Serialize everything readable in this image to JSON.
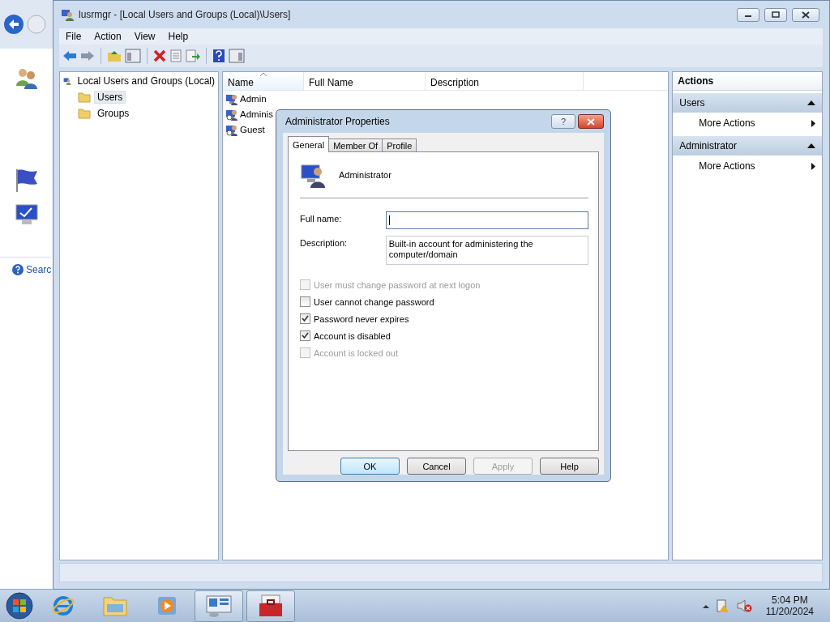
{
  "background_window": {
    "search_link": "Searc"
  },
  "window": {
    "title": "lusrmgr - [Local Users and Groups (Local)\\Users]"
  },
  "menu": [
    "File",
    "Action",
    "View",
    "Help"
  ],
  "tree": {
    "label": "Local Users and Groups (Local)",
    "children": [
      {
        "label": "Users",
        "selected": true
      },
      {
        "label": "Groups",
        "selected": false
      }
    ]
  },
  "list": {
    "columns": [
      {
        "label": "Name",
        "sorted": true
      },
      {
        "label": "Full Name",
        "sorted": false
      },
      {
        "label": "Description",
        "sorted": false
      }
    ],
    "rows": [
      {
        "name": "Admin",
        "disabled": false
      },
      {
        "name": "Adminis",
        "disabled": true
      },
      {
        "name": "Guest",
        "disabled": true
      }
    ]
  },
  "actions": {
    "title": "Actions",
    "sections": [
      {
        "title": "Users",
        "expanded": true,
        "items": [
          "More Actions"
        ]
      },
      {
        "title": "Administrator",
        "expanded": true,
        "items": [
          "More Actions"
        ]
      }
    ]
  },
  "dialog": {
    "title": "Administrator Properties",
    "help_button": "?",
    "tabs": [
      {
        "label": "General",
        "selected": true
      },
      {
        "label": "Member Of",
        "selected": false
      },
      {
        "label": "Profile",
        "selected": false
      }
    ],
    "user_name": "Administrator",
    "fields": [
      {
        "label": "Full name:",
        "focused": true
      },
      {
        "label": "Description:",
        "value": "Built-in account for administering the computer/domain",
        "focused": false
      }
    ],
    "checkboxes": [
      {
        "label": "User must change password at next logon",
        "checked": false,
        "disabled": true
      },
      {
        "label": "User cannot change password",
        "checked": false,
        "disabled": false
      },
      {
        "label": "Password never expires",
        "checked": true,
        "disabled": false
      },
      {
        "label": "Account is disabled",
        "checked": true,
        "disabled": false
      },
      {
        "label": "Account is locked out",
        "checked": false,
        "disabled": true
      }
    ],
    "buttons": [
      {
        "label": "OK",
        "disabled": false,
        "default": true
      },
      {
        "label": "Cancel",
        "disabled": false,
        "default": false
      },
      {
        "label": "Apply",
        "disabled": true,
        "default": false
      },
      {
        "label": "Help",
        "disabled": false,
        "default": false
      }
    ]
  },
  "taskbar": {
    "apps": [
      {
        "kind": "browser",
        "running": false
      },
      {
        "kind": "folder",
        "running": false
      },
      {
        "kind": "media",
        "running": false
      },
      {
        "kind": "console",
        "running": true
      },
      {
        "kind": "toolbox",
        "running": true
      }
    ],
    "time": "5:04 PM",
    "date": "11/20/2024"
  }
}
